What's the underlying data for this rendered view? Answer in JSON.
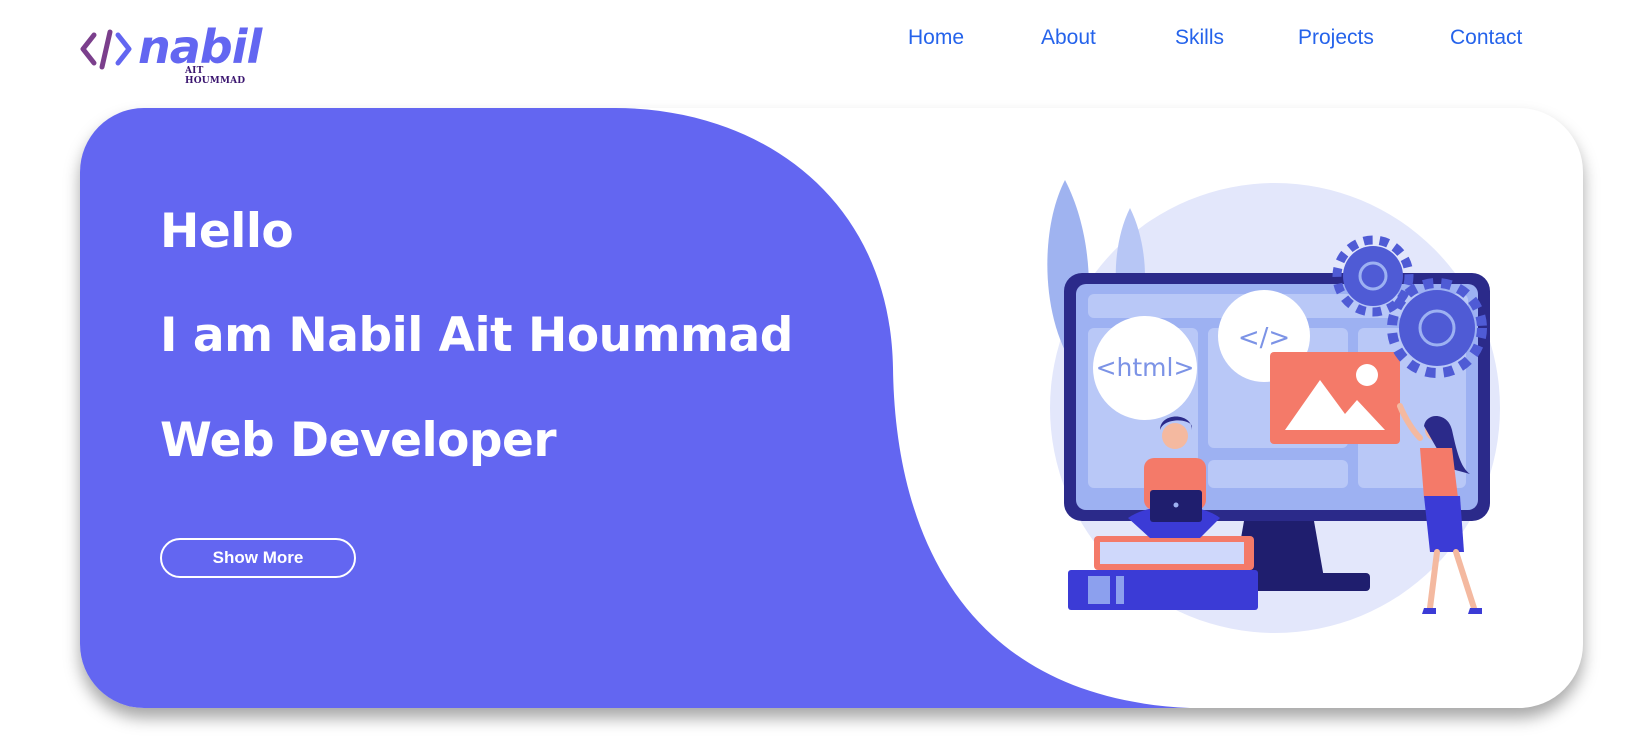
{
  "brand": {
    "name": "nabil",
    "subtitle": "AIT HOUMMAD",
    "icon": "code-brackets-icon",
    "colors": {
      "primary": "#6366f1",
      "bracket": "#7b3f8c",
      "subtitle": "#3b1670"
    }
  },
  "nav": {
    "items": [
      {
        "label": "Home"
      },
      {
        "label": "About"
      },
      {
        "label": "Skills"
      },
      {
        "label": "Projects"
      },
      {
        "label": "Contact"
      }
    ],
    "color": "#2563eb"
  },
  "hero": {
    "greeting": "Hello",
    "intro": "I am Nabil Ait Hoummad",
    "role": "Web Developer",
    "button_label": "Show More",
    "background": "#6366f1"
  },
  "illustration": {
    "html_tag": "<html>",
    "code_tag": "</>",
    "icons": [
      "monitor-icon",
      "gear-icon",
      "image-icon",
      "leaf-icon",
      "laptop-icon",
      "books-icon"
    ]
  }
}
